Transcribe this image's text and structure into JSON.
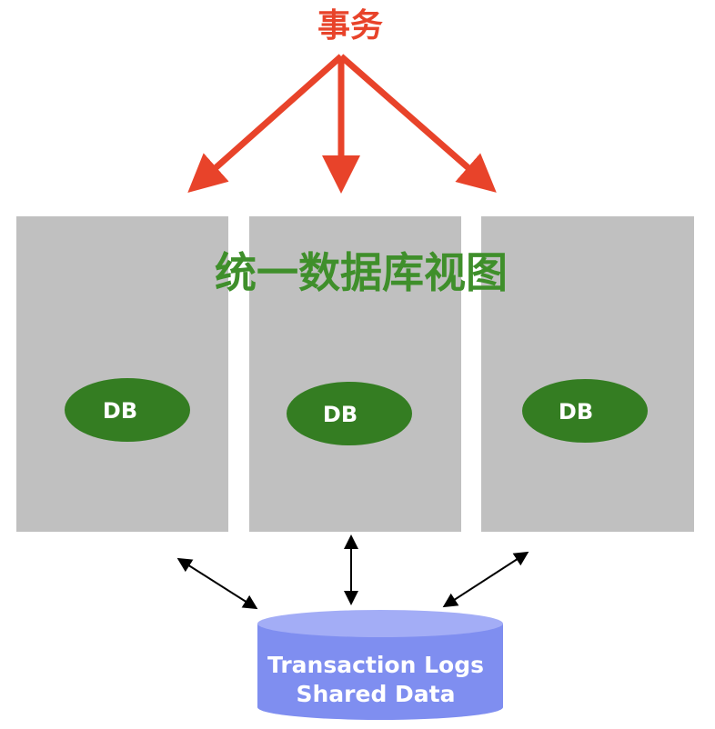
{
  "transaction_label": "事务",
  "unified_view_label": "统一数据库视图",
  "nodes": [
    {
      "label": "DB"
    },
    {
      "label": "DB"
    },
    {
      "label": "DB"
    }
  ],
  "storage": {
    "line1": "Transaction Logs",
    "line2": "Shared Data"
  },
  "colors": {
    "arrow_red": "#e8432a",
    "title_green": "#3f8f2b",
    "panel_gray": "#c0c0c0",
    "db_green": "#347d22",
    "cylinder_body": "#7f8ef0",
    "cylinder_top": "#a3adf6"
  }
}
